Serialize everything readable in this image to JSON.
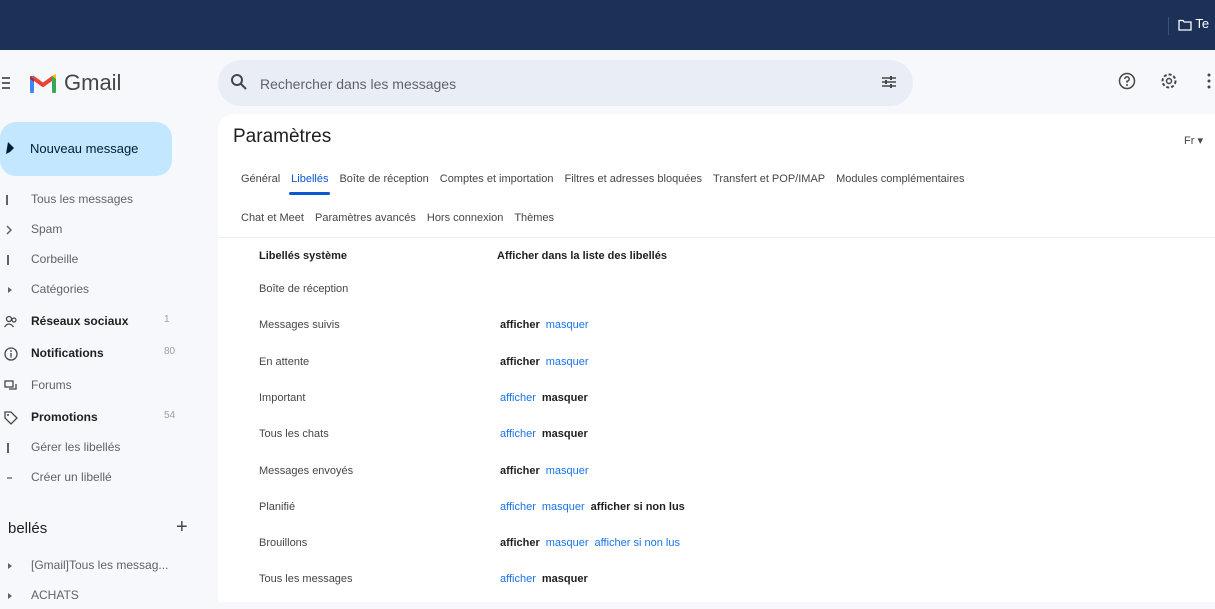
{
  "topbar": {
    "folder_label": "Te"
  },
  "app": {
    "name": "Gmail"
  },
  "search": {
    "placeholder": "Rechercher dans les messages"
  },
  "sidebar": {
    "compose_label": "Nouveau message",
    "items": [
      {
        "label": "Tous les messages",
        "count": "",
        "bold": false
      },
      {
        "label": "Spam",
        "count": "",
        "bold": false
      },
      {
        "label": "Corbeille",
        "count": "",
        "bold": false
      },
      {
        "label": "Catégories",
        "count": "",
        "bold": false
      },
      {
        "label": "Réseaux sociaux",
        "count": "1",
        "bold": true
      },
      {
        "label": "Notifications",
        "count": "80",
        "bold": true
      },
      {
        "label": "Forums",
        "count": "",
        "bold": false
      },
      {
        "label": "Promotions",
        "count": "54",
        "bold": true
      },
      {
        "label": "Gérer les libellés",
        "count": "",
        "bold": false
      },
      {
        "label": "Créer un libellé",
        "count": "",
        "bold": false
      }
    ],
    "labels_title": "bellés",
    "labels_add": "+",
    "user_labels": [
      {
        "label": "[Gmail]Tous les messag..."
      },
      {
        "label": "ACHATS"
      }
    ]
  },
  "settings": {
    "title": "Paramètres",
    "language": "Fr",
    "tabs_row1": [
      "Général",
      "Libellés",
      "Boîte de réception",
      "Comptes et importation",
      "Filtres et adresses bloquées",
      "Transfert et POP/IMAP",
      "Modules complémentaires"
    ],
    "tabs_row2": [
      "Chat et Meet",
      "Paramètres avancés",
      "Hors connexion",
      "Thèmes"
    ],
    "active_tab": "Libellés",
    "col_system": "Libellés système",
    "col_show": "Afficher dans la liste des libellés",
    "rows": [
      {
        "name": "Boîte de réception",
        "actions": []
      },
      {
        "name": "Messages suivis",
        "actions": [
          {
            "t": "afficher",
            "cur": true
          },
          {
            "t": "masquer",
            "cur": false
          }
        ]
      },
      {
        "name": "En attente",
        "actions": [
          {
            "t": "afficher",
            "cur": true
          },
          {
            "t": "masquer",
            "cur": false
          }
        ]
      },
      {
        "name": "Important",
        "actions": [
          {
            "t": "afficher",
            "cur": false
          },
          {
            "t": "masquer",
            "cur": true
          }
        ]
      },
      {
        "name": "Tous les chats",
        "actions": [
          {
            "t": "afficher",
            "cur": false
          },
          {
            "t": "masquer",
            "cur": true
          }
        ]
      },
      {
        "name": "Messages envoyés",
        "actions": [
          {
            "t": "afficher",
            "cur": true
          },
          {
            "t": "masquer",
            "cur": false
          }
        ]
      },
      {
        "name": "Planifié",
        "actions": [
          {
            "t": "afficher",
            "cur": false
          },
          {
            "t": "masquer",
            "cur": false
          },
          {
            "t": "afficher si non lus",
            "cur": true
          }
        ]
      },
      {
        "name": "Brouillons",
        "actions": [
          {
            "t": "afficher",
            "cur": true
          },
          {
            "t": "masquer",
            "cur": false
          },
          {
            "t": "afficher si non lus",
            "cur": false
          }
        ]
      },
      {
        "name": "Tous les messages",
        "actions": [
          {
            "t": "afficher",
            "cur": false
          },
          {
            "t": "masquer",
            "cur": true
          }
        ]
      }
    ]
  },
  "colors": {
    "topbar": "#1b3158",
    "accent": "#0b57d0",
    "compose": "#c2e7ff",
    "link": "#1a73e8"
  }
}
